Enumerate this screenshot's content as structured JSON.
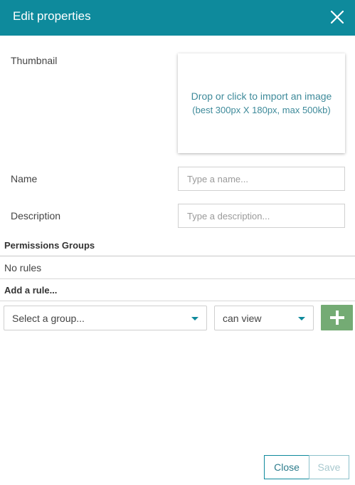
{
  "header": {
    "title": "Edit properties"
  },
  "form": {
    "thumbnail_label": "Thumbnail",
    "thumbnail_drop_line1": "Drop or click to import an image",
    "thumbnail_drop_line2": "(best 300px X 180px, max 500kb)",
    "name_label": "Name",
    "name_placeholder": "Type a name...",
    "name_value": "",
    "description_label": "Description",
    "description_placeholder": "Type a description...",
    "description_value": ""
  },
  "permissions": {
    "section_title": "Permissions Groups",
    "empty_text": "No rules",
    "add_rule_title": "Add a rule...",
    "group_select_value": "Select a group...",
    "access_select_value": "can view"
  },
  "footer": {
    "close_label": "Close",
    "save_label": "Save"
  },
  "colors": {
    "accent": "#0e8a9c",
    "add_button": "#74ab74"
  },
  "icons": {
    "close": "close-icon",
    "add": "plus-icon",
    "dropdown": "chevron-down-icon"
  }
}
